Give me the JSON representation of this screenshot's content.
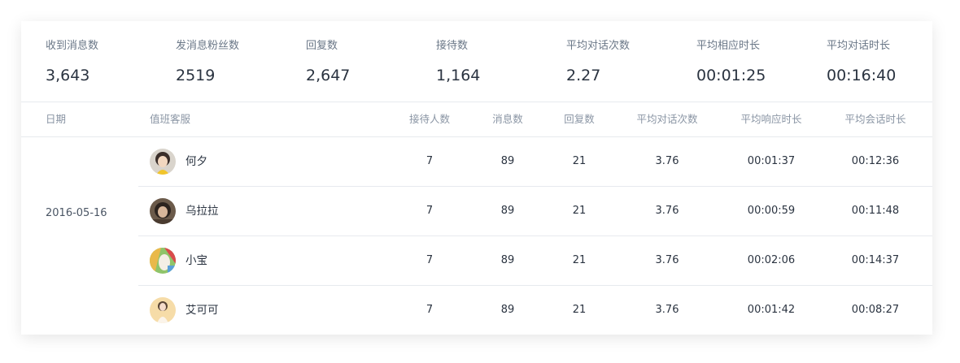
{
  "stats": [
    {
      "label": "收到消息数",
      "value": "3,643"
    },
    {
      "label": "发消息粉丝数",
      "value": "2519"
    },
    {
      "label": "回复数",
      "value": "2,647"
    },
    {
      "label": "接待数",
      "value": "1,164"
    },
    {
      "label": "平均对话次数",
      "value": "2.27"
    },
    {
      "label": "平均相应时长",
      "value": "00:01:25"
    },
    {
      "label": "平均对话时长",
      "value": "00:16:40"
    }
  ],
  "table": {
    "headers": [
      "日期",
      "值班客服",
      "接待人数",
      "消息数",
      "回复数",
      "平均对话次数",
      "平均响应时长",
      "平均会话时长"
    ],
    "date": "2016-05-16",
    "rows": [
      {
        "name": "何夕",
        "reception": "7",
        "messages": "89",
        "replies": "21",
        "avg_dialogs": "3.76",
        "avg_response": "00:01:37",
        "avg_session": "00:12:36"
      },
      {
        "name": "乌拉拉",
        "reception": "7",
        "messages": "89",
        "replies": "21",
        "avg_dialogs": "3.76",
        "avg_response": "00:00:59",
        "avg_session": "00:11:48"
      },
      {
        "name": "小宝",
        "reception": "7",
        "messages": "89",
        "replies": "21",
        "avg_dialogs": "3.76",
        "avg_response": "00:02:06",
        "avg_session": "00:14:37"
      },
      {
        "name": "艾可可",
        "reception": "7",
        "messages": "89",
        "replies": "21",
        "avg_dialogs": "3.76",
        "avg_response": "00:01:42",
        "avg_session": "00:08:27"
      }
    ]
  }
}
